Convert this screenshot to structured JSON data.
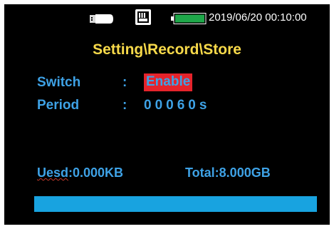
{
  "status_bar": {
    "datetime": "2019/06/20 00:10:00",
    "icons": [
      "usb-icon",
      "sd-card-icon",
      "battery-icon"
    ],
    "battery_color": "#1fa84a"
  },
  "title": "Setting\\Record\\Store",
  "settings": {
    "switch": {
      "label": "Switch",
      "separator": ":",
      "value": "Enable",
      "highlight_color": "#e5232b"
    },
    "period": {
      "label": "Period",
      "separator": ":",
      "value": "00060s"
    }
  },
  "storage": {
    "used_label": "Uesd",
    "used_value": "0.000KB",
    "total_label": "Total",
    "total_value": "8.000GB",
    "progress_fraction": 1.0,
    "progress_color": "#18a3e0"
  },
  "colors": {
    "background": "#000000",
    "title": "#f7d94a",
    "text": "#3ea2e6"
  }
}
